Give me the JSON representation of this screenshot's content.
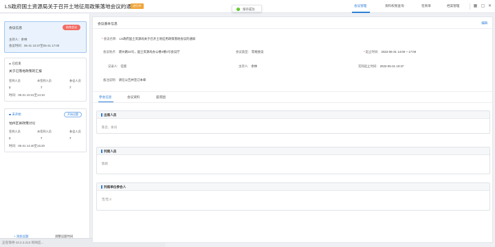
{
  "header": {
    "title": "LS政府国土资源局关于召开土地征用政策落地会议的通知",
    "badge": "进行中",
    "toast": "保存成功",
    "tabs": [
      "会议管理",
      "资料权限查询",
      "签到单",
      "档案管理"
    ],
    "active_tab": 0,
    "icons": [
      "grid-icon",
      "window-icon",
      "close-icon"
    ]
  },
  "sidebar": {
    "cards": [
      {
        "title": "会议信息",
        "status_button": "结束会议",
        "host_label": "主持人：",
        "host": "余林",
        "time_label": "会议时间：",
        "time": "05-31 10:37至05-31 17:00"
      },
      {
        "status": "已结束",
        "status_color": "#999999",
        "title": "关于已落地政策的汇报",
        "stats": [
          {
            "label": "签到人员",
            "value": "0"
          },
          {
            "label": "未签到人员",
            "value": "7"
          },
          {
            "label": "参会人员",
            "value": "7"
          }
        ],
        "time_label": "时间：",
        "time": "05-31 10:41至14:10"
      },
      {
        "status": "未开始",
        "status_color": "#2f7fd6",
        "action_button": "开始议题",
        "title": "怕州区县政策讨论",
        "stats": [
          {
            "label": "签到人员",
            "value": "0"
          },
          {
            "label": "未签到人员",
            "value": "7"
          },
          {
            "label": "参会人员",
            "value": "7"
          }
        ],
        "time_label": "时间：",
        "time": "05-31 14:40至15:20"
      }
    ],
    "footer": {
      "add_topic": "+ 添加议题",
      "adjust_time": "调整议题时间"
    }
  },
  "status_bar": {
    "text": "正在等待 10.2.3.213 的响应..."
  },
  "main": {
    "section_title": "会议基本信息",
    "edit_link": "编辑",
    "fields": {
      "name_label": "会议名称:",
      "name_value": "LS政府国土资源局关于召开土地征用政策落地会议的通知",
      "place_label": "会议地点:",
      "place_value": "建州路33号，国土资源局办公楼4楼2号会议厅",
      "type_label": "会议类型:",
      "type_value": "常规会议",
      "time_label": "起止时间:",
      "time_value": "2022-05-31 14:00 ~ 17:00",
      "recorder_label": "记录人:",
      "recorder_value": "任欣",
      "host_label": "主持人:",
      "host_value": "余林",
      "actual_label": "实际起止时间:",
      "actual_value": "2022-05-31 10:37",
      "note_label": "备注说明:",
      "note_value": "请在公告并签订本章"
    },
    "tabs": [
      "参会信息",
      "会议资料",
      "座席图"
    ],
    "active_tab": 0,
    "panels": [
      {
        "title": "出席人员",
        "body": "陈云、余问"
      },
      {
        "title": "列席人员",
        "body": "陈刚"
      },
      {
        "title": "列席单位参会人",
        "body": "无/无-2"
      }
    ]
  },
  "colors": {
    "accent": "#2f7fd6",
    "danger": "#f26b63",
    "badge": "#f0a43a",
    "success": "#52c41a"
  }
}
